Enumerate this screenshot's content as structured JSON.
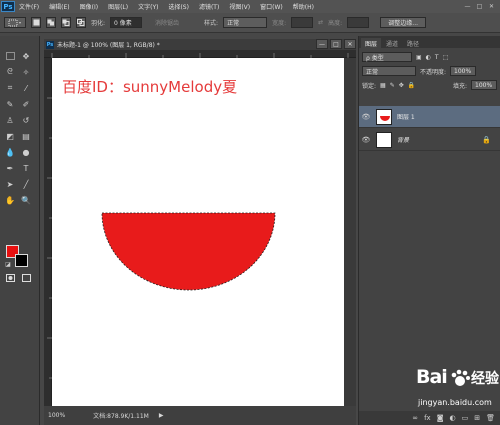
{
  "menubar": {
    "logo": "Ps",
    "items": [
      "文件(F)",
      "编辑(E)",
      "图像(I)",
      "图层(L)",
      "文字(Y)",
      "选择(S)",
      "滤镜(T)",
      "视图(V)",
      "窗口(W)",
      "帮助(H)"
    ],
    "window_buttons": [
      "—",
      "□",
      "✕"
    ]
  },
  "options": {
    "feather_label": "羽化:",
    "feather_value": "0 像素",
    "antialias_label": "消除锯齿",
    "style_label": "样式:",
    "style_value": "正常",
    "width_label": "宽度:",
    "height_label": "高度:",
    "refine_edge_button": "调整边缘..."
  },
  "document": {
    "tab_title": "未标题-1 @ 100% (图层 1, RGB/8) *",
    "canvas_text": "百度ID：sunnyMelody夏",
    "shape_color": "#e81b1b",
    "zoom": "100%",
    "doc_info": "文档:878.9K/1.11M"
  },
  "tools": {
    "foreground_color": "#e81010",
    "background_color": "#000000"
  },
  "layers_panel": {
    "tabs": [
      "图层",
      "通道",
      "路径"
    ],
    "filter_kind": "ρ 类型",
    "blend_mode": "正常",
    "opacity_label": "不透明度:",
    "opacity_value": "100%",
    "lock_label": "锁定:",
    "fill_label": "填充:",
    "fill_value": "100%",
    "layers": [
      {
        "name": "图层 1",
        "visible": true,
        "selected": true
      },
      {
        "name": "背景",
        "visible": true,
        "selected": false,
        "locked": true
      }
    ]
  },
  "watermark": {
    "brand_text": "Bai",
    "brand_text2": "经验",
    "url": "jingyan.baidu.com"
  }
}
